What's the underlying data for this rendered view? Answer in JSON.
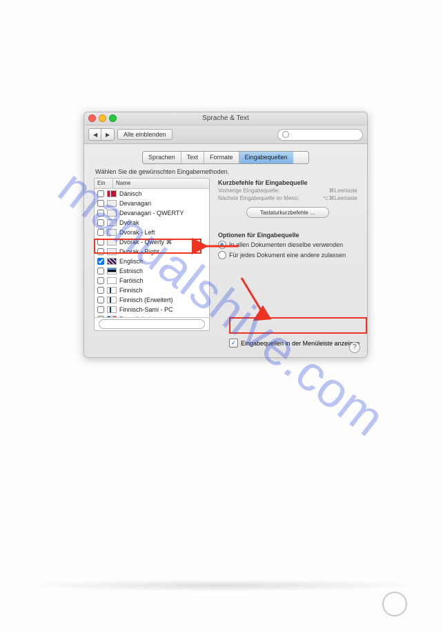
{
  "window": {
    "title": "Sprache & Text"
  },
  "toolbar": {
    "back": "◀",
    "forward": "▶",
    "show_all": "Alle einblenden",
    "search_placeholder": ""
  },
  "tabs": {
    "items": [
      "Sprachen",
      "Text",
      "Formate",
      "Eingabequellen"
    ],
    "active_index": 3
  },
  "instruction": "Wählen Sie die gewünschten Eingabemethoden.",
  "list": {
    "headers": {
      "ein": "Ein",
      "name": "Name"
    },
    "items": [
      {
        "checked": false,
        "flag": "dk",
        "label": "Dänisch"
      },
      {
        "checked": false,
        "flag": "",
        "label": "Devanagari"
      },
      {
        "checked": false,
        "flag": "",
        "label": "Devanagari - QWERTY"
      },
      {
        "checked": false,
        "flag": "",
        "label": "Dvorak"
      },
      {
        "checked": false,
        "flag": "",
        "label": "Dvorak - Left"
      },
      {
        "checked": false,
        "flag": "",
        "label": "Dvorak - Qwerty ⌘"
      },
      {
        "checked": false,
        "flag": "",
        "label": "Dvorak - Right"
      },
      {
        "checked": true,
        "flag": "uk",
        "label": "Englisch"
      },
      {
        "checked": false,
        "flag": "ee",
        "label": "Estnisch"
      },
      {
        "checked": false,
        "flag": "fo",
        "label": "Faröisch"
      },
      {
        "checked": false,
        "flag": "fi",
        "label": "Finnisch"
      },
      {
        "checked": false,
        "flag": "fi",
        "label": "Finnisch (Erweitert)"
      },
      {
        "checked": false,
        "flag": "fi",
        "label": "Finnisch-Sami - PC"
      },
      {
        "checked": false,
        "flag": "fr",
        "label": "Französisch"
      }
    ]
  },
  "shortcuts": {
    "title": "Kurzbefehle für Eingabequelle",
    "prev_label": "Vorherige Eingabequelle:",
    "prev_key": "⌘Leertaste",
    "next_label": "Nächste Eingabequelle im Menü:",
    "next_key": "⌥⌘Leertaste",
    "button": "Tastaturkurzbefehle …"
  },
  "options": {
    "title": "Optionen für Eingabequelle",
    "radio1": "In allen Dokumenten dieselbe verwenden",
    "radio2": "Für jedes Dokument eine andere zulassen",
    "selected": 0
  },
  "menubar": {
    "checked": true,
    "label": "Eingabequellen in der Menüleiste anzeigen"
  },
  "watermark": "manualshive.com",
  "help": "?"
}
